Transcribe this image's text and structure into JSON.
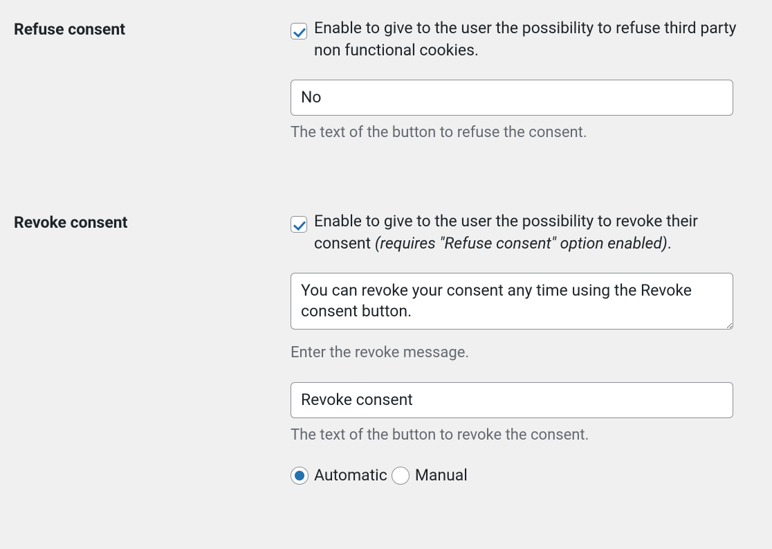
{
  "refuse": {
    "label": "Refuse consent",
    "checkbox_text": "Enable to give to the user the possibility to refuse third party non functional cookies.",
    "checked": true,
    "button_text_value": "No",
    "button_text_help": "The text of the button to refuse the consent."
  },
  "revoke": {
    "label": "Revoke consent",
    "checkbox_text_prefix": "Enable to give to the user the possibility to revoke their consent ",
    "checkbox_text_italic": "(requires \"Refuse consent\" option enabled)",
    "checkbox_text_suffix": ".",
    "checked": true,
    "message_value": "You can revoke your consent any time using the Revoke consent button.",
    "message_help": "Enter the revoke message.",
    "button_text_value": "Revoke consent",
    "button_text_help": "The text of the button to revoke the consent.",
    "mode": {
      "options": {
        "automatic": "Automatic",
        "manual": "Manual"
      },
      "selected": "automatic"
    }
  }
}
